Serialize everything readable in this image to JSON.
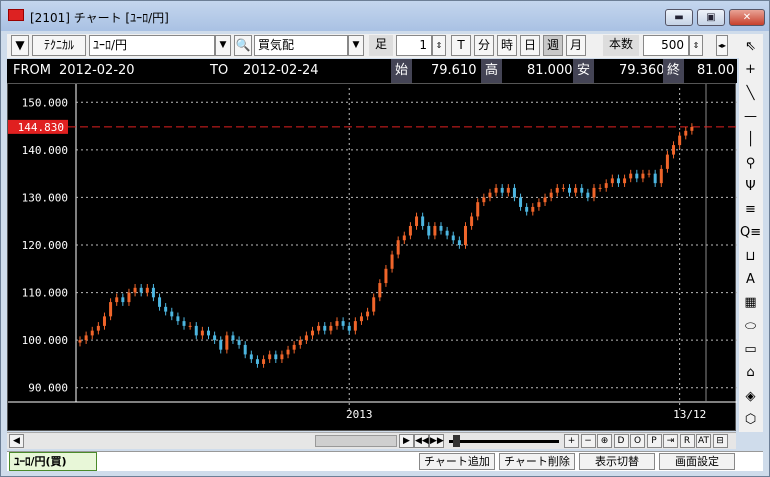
{
  "window": {
    "title": "[2101] チャート [ﾕｰﾛ/円]",
    "minimize": "▬",
    "maximize": "▣",
    "close": "✕"
  },
  "toolbar": {
    "menu_arrow": "▼",
    "technical": "ﾃｸﾆｶﾙ",
    "symbol": "ﾕｰﾛ/円",
    "search_icon": "🔍",
    "side": "買気配",
    "ashi_label": "足",
    "ashi_value": "1",
    "units": [
      "T",
      "分",
      "時",
      "日",
      "週",
      "月"
    ],
    "selected_unit": "週",
    "count_label": "本数",
    "count_value": "500"
  },
  "info": {
    "from_label": "FROM",
    "from_value": "2012-02-20",
    "to_label": "TO",
    "to_value": "2012-02-24",
    "open_label": "始",
    "open_value": "79.610",
    "high_label": "高",
    "high_value": "81.000",
    "low_label": "安",
    "low_value": "79.360",
    "close_label": "終",
    "close_value": "81.00"
  },
  "chart_data": {
    "type": "candlestick",
    "y_ticks": [
      "150.000",
      "140.000",
      "130.000",
      "120.000",
      "110.000",
      "100.000",
      "90.000"
    ],
    "ylim": [
      87,
      153
    ],
    "x_labels": [
      "2013",
      "13/12"
    ],
    "current_price": "144.830",
    "colors": {
      "up": "#f0652a",
      "down": "#4db6e0",
      "price_line": "#e02020",
      "grid": "#bbbbbb"
    },
    "closes": [
      100,
      101,
      102,
      103,
      105,
      108,
      109,
      108,
      110,
      111,
      110,
      111,
      109,
      107,
      106,
      105,
      104,
      103,
      103,
      101,
      102,
      101,
      100,
      98,
      101,
      100,
      99,
      97,
      96,
      95,
      96,
      97,
      96,
      97,
      98,
      99,
      100,
      101,
      102,
      103,
      102,
      103,
      104,
      103,
      102,
      104,
      105,
      106,
      109,
      112,
      115,
      118,
      121,
      122,
      124,
      126,
      124,
      122,
      124,
      123,
      122,
      121,
      120,
      124,
      126,
      129,
      130,
      131,
      132,
      131,
      132,
      130,
      128,
      127,
      128,
      129,
      130,
      131,
      132,
      132,
      131,
      132,
      131,
      130,
      132,
      132,
      133,
      134,
      133,
      134,
      135,
      134,
      135,
      135,
      133,
      136,
      139,
      141,
      143,
      144,
      144.8
    ]
  },
  "scroll": {
    "buttons": [
      "▶",
      "◀◀",
      "▶▶"
    ],
    "right_buttons": [
      "+",
      "−",
      "⊕",
      "D",
      "O",
      "P",
      "⇥",
      "R",
      "AT",
      "⊟"
    ]
  },
  "right_tools": [
    "⇖",
    "+",
    "╲",
    "—",
    "│",
    "⚲",
    "Ψ",
    "≡",
    "Q≡",
    "⊔",
    "A",
    "▦",
    "⬭",
    "▭",
    "⌂",
    "◈",
    "⬡"
  ],
  "bottom": {
    "tab": "ﾕｰﾛ/円(買)",
    "buttons": [
      "チャート追加",
      "チャート削除",
      "表示切替",
      "画面設定"
    ]
  }
}
